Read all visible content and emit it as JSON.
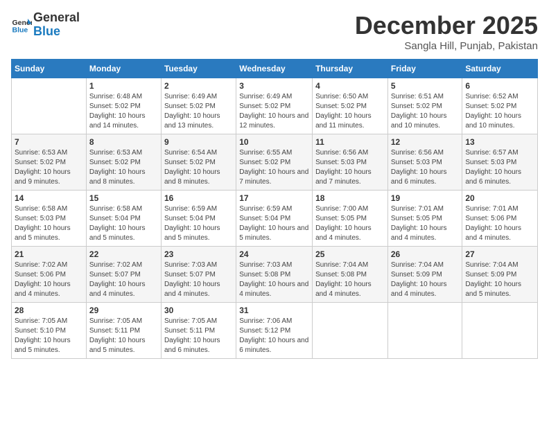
{
  "header": {
    "logo_line1": "General",
    "logo_line2": "Blue",
    "month_title": "December 2025",
    "location": "Sangla Hill, Punjab, Pakistan"
  },
  "days_of_week": [
    "Sunday",
    "Monday",
    "Tuesday",
    "Wednesday",
    "Thursday",
    "Friday",
    "Saturday"
  ],
  "weeks": [
    [
      {
        "day": "",
        "sunrise": "",
        "sunset": "",
        "daylight": "",
        "empty": true
      },
      {
        "day": "1",
        "sunrise": "Sunrise: 6:48 AM",
        "sunset": "Sunset: 5:02 PM",
        "daylight": "Daylight: 10 hours and 14 minutes."
      },
      {
        "day": "2",
        "sunrise": "Sunrise: 6:49 AM",
        "sunset": "Sunset: 5:02 PM",
        "daylight": "Daylight: 10 hours and 13 minutes."
      },
      {
        "day": "3",
        "sunrise": "Sunrise: 6:49 AM",
        "sunset": "Sunset: 5:02 PM",
        "daylight": "Daylight: 10 hours and 12 minutes."
      },
      {
        "day": "4",
        "sunrise": "Sunrise: 6:50 AM",
        "sunset": "Sunset: 5:02 PM",
        "daylight": "Daylight: 10 hours and 11 minutes."
      },
      {
        "day": "5",
        "sunrise": "Sunrise: 6:51 AM",
        "sunset": "Sunset: 5:02 PM",
        "daylight": "Daylight: 10 hours and 10 minutes."
      },
      {
        "day": "6",
        "sunrise": "Sunrise: 6:52 AM",
        "sunset": "Sunset: 5:02 PM",
        "daylight": "Daylight: 10 hours and 10 minutes."
      }
    ],
    [
      {
        "day": "7",
        "sunrise": "Sunrise: 6:53 AM",
        "sunset": "Sunset: 5:02 PM",
        "daylight": "Daylight: 10 hours and 9 minutes."
      },
      {
        "day": "8",
        "sunrise": "Sunrise: 6:53 AM",
        "sunset": "Sunset: 5:02 PM",
        "daylight": "Daylight: 10 hours and 8 minutes."
      },
      {
        "day": "9",
        "sunrise": "Sunrise: 6:54 AM",
        "sunset": "Sunset: 5:02 PM",
        "daylight": "Daylight: 10 hours and 8 minutes."
      },
      {
        "day": "10",
        "sunrise": "Sunrise: 6:55 AM",
        "sunset": "Sunset: 5:02 PM",
        "daylight": "Daylight: 10 hours and 7 minutes."
      },
      {
        "day": "11",
        "sunrise": "Sunrise: 6:56 AM",
        "sunset": "Sunset: 5:03 PM",
        "daylight": "Daylight: 10 hours and 7 minutes."
      },
      {
        "day": "12",
        "sunrise": "Sunrise: 6:56 AM",
        "sunset": "Sunset: 5:03 PM",
        "daylight": "Daylight: 10 hours and 6 minutes."
      },
      {
        "day": "13",
        "sunrise": "Sunrise: 6:57 AM",
        "sunset": "Sunset: 5:03 PM",
        "daylight": "Daylight: 10 hours and 6 minutes."
      }
    ],
    [
      {
        "day": "14",
        "sunrise": "Sunrise: 6:58 AM",
        "sunset": "Sunset: 5:03 PM",
        "daylight": "Daylight: 10 hours and 5 minutes."
      },
      {
        "day": "15",
        "sunrise": "Sunrise: 6:58 AM",
        "sunset": "Sunset: 5:04 PM",
        "daylight": "Daylight: 10 hours and 5 minutes."
      },
      {
        "day": "16",
        "sunrise": "Sunrise: 6:59 AM",
        "sunset": "Sunset: 5:04 PM",
        "daylight": "Daylight: 10 hours and 5 minutes."
      },
      {
        "day": "17",
        "sunrise": "Sunrise: 6:59 AM",
        "sunset": "Sunset: 5:04 PM",
        "daylight": "Daylight: 10 hours and 5 minutes."
      },
      {
        "day": "18",
        "sunrise": "Sunrise: 7:00 AM",
        "sunset": "Sunset: 5:05 PM",
        "daylight": "Daylight: 10 hours and 4 minutes."
      },
      {
        "day": "19",
        "sunrise": "Sunrise: 7:01 AM",
        "sunset": "Sunset: 5:05 PM",
        "daylight": "Daylight: 10 hours and 4 minutes."
      },
      {
        "day": "20",
        "sunrise": "Sunrise: 7:01 AM",
        "sunset": "Sunset: 5:06 PM",
        "daylight": "Daylight: 10 hours and 4 minutes."
      }
    ],
    [
      {
        "day": "21",
        "sunrise": "Sunrise: 7:02 AM",
        "sunset": "Sunset: 5:06 PM",
        "daylight": "Daylight: 10 hours and 4 minutes."
      },
      {
        "day": "22",
        "sunrise": "Sunrise: 7:02 AM",
        "sunset": "Sunset: 5:07 PM",
        "daylight": "Daylight: 10 hours and 4 minutes."
      },
      {
        "day": "23",
        "sunrise": "Sunrise: 7:03 AM",
        "sunset": "Sunset: 5:07 PM",
        "daylight": "Daylight: 10 hours and 4 minutes."
      },
      {
        "day": "24",
        "sunrise": "Sunrise: 7:03 AM",
        "sunset": "Sunset: 5:08 PM",
        "daylight": "Daylight: 10 hours and 4 minutes."
      },
      {
        "day": "25",
        "sunrise": "Sunrise: 7:04 AM",
        "sunset": "Sunset: 5:08 PM",
        "daylight": "Daylight: 10 hours and 4 minutes."
      },
      {
        "day": "26",
        "sunrise": "Sunrise: 7:04 AM",
        "sunset": "Sunset: 5:09 PM",
        "daylight": "Daylight: 10 hours and 4 minutes."
      },
      {
        "day": "27",
        "sunrise": "Sunrise: 7:04 AM",
        "sunset": "Sunset: 5:09 PM",
        "daylight": "Daylight: 10 hours and 5 minutes."
      }
    ],
    [
      {
        "day": "28",
        "sunrise": "Sunrise: 7:05 AM",
        "sunset": "Sunset: 5:10 PM",
        "daylight": "Daylight: 10 hours and 5 minutes."
      },
      {
        "day": "29",
        "sunrise": "Sunrise: 7:05 AM",
        "sunset": "Sunset: 5:11 PM",
        "daylight": "Daylight: 10 hours and 5 minutes."
      },
      {
        "day": "30",
        "sunrise": "Sunrise: 7:05 AM",
        "sunset": "Sunset: 5:11 PM",
        "daylight": "Daylight: 10 hours and 6 minutes."
      },
      {
        "day": "31",
        "sunrise": "Sunrise: 7:06 AM",
        "sunset": "Sunset: 5:12 PM",
        "daylight": "Daylight: 10 hours and 6 minutes."
      },
      {
        "day": "",
        "sunrise": "",
        "sunset": "",
        "daylight": "",
        "empty": true
      },
      {
        "day": "",
        "sunrise": "",
        "sunset": "",
        "daylight": "",
        "empty": true
      },
      {
        "day": "",
        "sunrise": "",
        "sunset": "",
        "daylight": "",
        "empty": true
      }
    ]
  ]
}
